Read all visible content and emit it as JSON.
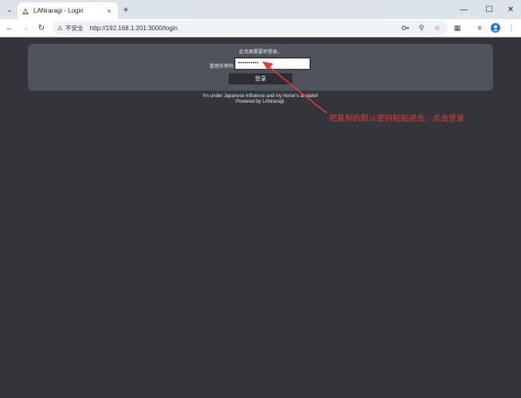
{
  "browser": {
    "tab_title": "LANraragi - Login",
    "tab_close": "×",
    "new_tab": "+",
    "security_label": "不安全",
    "url": "http://192.168.1.201:3000/login"
  },
  "login": {
    "prompt": "此页面需要密登录。",
    "password_label": "管理员密码:",
    "password_value": "••••••••••",
    "submit_label": "登录"
  },
  "footer": {
    "line1": "I'm under Japanese influence and my honor's at stake!",
    "line2": "Powered by LANraragi."
  },
  "annotation": {
    "text": "把复制的默认密码粘贴进去，点击登录",
    "color": "#e53935"
  }
}
